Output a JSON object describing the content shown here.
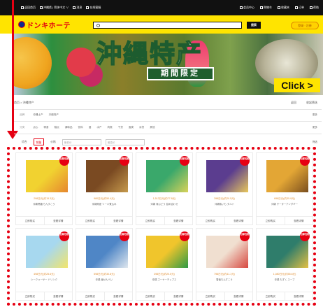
{
  "topbar": {
    "left_items": [
      "返回首页",
      "沖縄県 | 简体中文 ∨",
      "消息",
      "在线客服"
    ],
    "right_items": [
      "会员中心",
      "购物车",
      "收藏夹",
      "订单",
      "帮助"
    ]
  },
  "header": {
    "logo_text": "ドンキホーテ",
    "search_placeholder": "",
    "search_button": "搜索",
    "login_label": "登录 · 注册"
  },
  "banner": {
    "title": "沖縄特产",
    "tag": "期間限定",
    "click_label": "Click >"
  },
  "breadcrumb": "首页 > 沖縄特产",
  "breadcrumb_right": [
    "返回",
    "收起筛选"
  ],
  "filters": {
    "row1_label": "品牌",
    "row1_items": [
      "沖縄土产",
      "冲绳特产"
    ],
    "row2_label": "分类",
    "row2_items": [
      "点心",
      "零食",
      "糕点",
      "调味品",
      "饮料",
      "酒",
      "水产",
      "肉类",
      "干货",
      "面类",
      "杂货",
      "其他"
    ],
    "more": "更多"
  },
  "sort": {
    "options": [
      "综合",
      "销量",
      "价格"
    ],
    "active_index": 1,
    "price_min_placeholder": "最低价",
    "price_max_placeholder": "最高价",
    "right_label": "筛选"
  },
  "products": [
    {
      "price": "298日元(约15.3元)",
      "name": "沖縄黒糖 ちんすこう",
      "badge": "包邮包税",
      "colors": [
        "#f1d230",
        "#e6872f"
      ]
    },
    {
      "price": "980日元(约50.4元)",
      "name": "沖縄県産 ソーキ煮込み",
      "badge": "包邮包税",
      "colors": [
        "#7a4a22",
        "#c69a4d"
      ]
    },
    {
      "price": "1,512日元(约77.8元)",
      "name": "沖縄 海ぶどう 詰め合わせ",
      "badge": "包邮包税",
      "colors": [
        "#3aa86b",
        "#d9d25a"
      ]
    },
    {
      "price": "398日元(约20.5元)",
      "name": "沖縄紫いも タルト",
      "badge": "包邮包税",
      "colors": [
        "#5b3d8f",
        "#e8c85b"
      ]
    },
    {
      "price": "698日元(约35.9元)",
      "name": "沖縄 サーターアンダギー",
      "badge": "包邮包税",
      "colors": [
        "#e3a635",
        "#7a4f1f"
      ]
    },
    {
      "price": "498日元(约25.6元)",
      "name": "シークヮーサー ドリンク",
      "badge": "包邮包税",
      "colors": [
        "#a7d8ef",
        "#f2e56b"
      ]
    },
    {
      "price": "598日元(约30.8元)",
      "name": "沖縄 塩せんべい",
      "badge": "包邮包税",
      "colors": [
        "#4f86c6",
        "#dfe7ee"
      ]
    },
    {
      "price": "398日元(约20.5元)",
      "name": "沖縄 ゴーヤーチップス",
      "badge": "包邮包税",
      "colors": [
        "#f0c52c",
        "#2f9a45"
      ]
    },
    {
      "price": "798日元(约41.1元)",
      "name": "雪塩ちんすこう",
      "badge": "包邮包税",
      "colors": [
        "#f0dfd0",
        "#d7473f"
      ]
    },
    {
      "price": "1,080日元(约55.6元)",
      "name": "沖縄 もずく スープ",
      "badge": "包邮包税",
      "colors": [
        "#2f7d6b",
        "#e3c044"
      ]
    }
  ],
  "card_actions": [
    "立即购买",
    "查看详情"
  ]
}
